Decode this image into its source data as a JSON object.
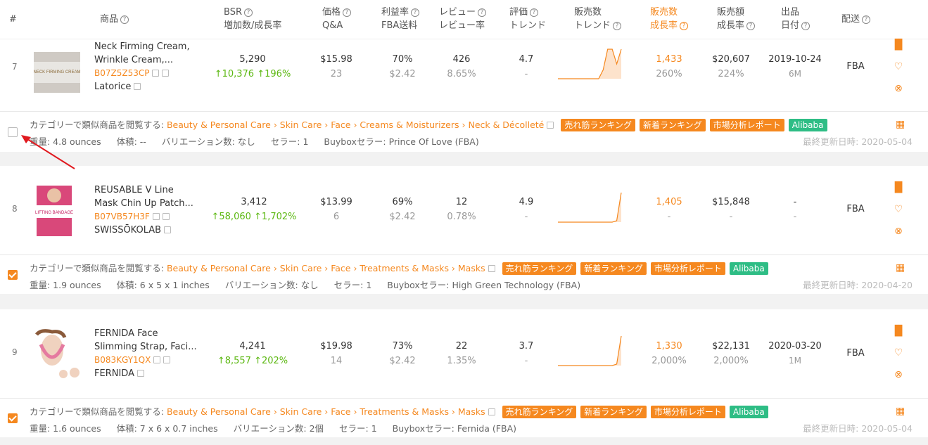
{
  "header": {
    "index": "#",
    "product": "商品",
    "bsr_line1": "BSR",
    "bsr_line2": "増加数/成長率",
    "price_line1": "価格",
    "price_line2": "Q&A",
    "profit_line1": "利益率",
    "profit_line2": "FBA送料",
    "review_line1": "レビュー",
    "review_line2": "レビュー率",
    "rating_line1": "評価",
    "rating_line2": "トレンド",
    "sales_line1": "販売数",
    "sales_line2": "トレンド",
    "salesgrowth_line1": "販売数",
    "salesgrowth_line2": "成長率",
    "revenue_line1": "販売額",
    "revenue_line2": "成長率",
    "listed_line1": "出品",
    "listed_line2": "日付",
    "ship": "配送",
    "accent_color": "#f5881f"
  },
  "rows": [
    {
      "index": "7",
      "name_line1": "Neck Firming Cream,",
      "name_line2": "Wrinkle Cream,...",
      "asin": "B07Z5Z53CP",
      "brand": "Latorice",
      "bsr": "5,290",
      "bsr_inc": "10,376",
      "bsr_rate": "196%",
      "price": "$15.98",
      "qa": "23",
      "profit": "70%",
      "fba": "$2.42",
      "reviews": "426",
      "review_rate": "8.65%",
      "rating": "4.7",
      "rating_trend": "-",
      "sales": "1,433",
      "sales_growth": "260%",
      "revenue": "$20,607",
      "revenue_growth": "224%",
      "date": "2019-10-24",
      "age": "6M",
      "ship": "FBA",
      "category_label": "カテゴリーで類似商品を閲覧する:",
      "category_path": "Beauty & Personal Care › Skin Care › Face › Creams & Moisturizers › Neck & Décolleté",
      "tag1": "売れ筋ランキング",
      "tag2": "新着ランキング",
      "tag3": "市場分析レポート",
      "tag4": "Alibaba",
      "weight": "重量: 4.8 ounces",
      "volume": "体積: --",
      "variation": "バリエーション数: なし",
      "seller": "セラー: 1",
      "buybox": "Buyboxセラー:  Prince Of Love (FBA)",
      "updated": "最終更新日時: 2020-05-04",
      "checked": false,
      "thumb_text": "NECK FIRMING CREAM",
      "sales_trend": [
        0,
        0,
        0,
        0,
        0,
        0,
        0,
        0,
        0,
        0,
        0.3,
        1,
        1,
        0.5,
        1
      ]
    },
    {
      "index": "8",
      "name_line1": "REUSABLE V Line",
      "name_line2": "Mask Chin Up Patch...",
      "asin": "B07VB57H3F",
      "brand": "SWISSŌKOLAB",
      "bsr": "3,412",
      "bsr_inc": "58,060",
      "bsr_rate": "1,702%",
      "price": "$13.99",
      "qa": "6",
      "profit": "69%",
      "fba": "$2.42",
      "reviews": "12",
      "review_rate": "0.78%",
      "rating": "4.9",
      "rating_trend": "-",
      "sales": "1,405",
      "sales_growth": "-",
      "revenue": "$15,848",
      "revenue_growth": "-",
      "date": "-",
      "age": "-",
      "ship": "FBA",
      "category_label": "カテゴリーで類似商品を閲覧する:",
      "category_path": "Beauty & Personal Care › Skin Care › Face › Treatments & Masks › Masks",
      "tag1": "売れ筋ランキング",
      "tag2": "新着ランキング",
      "tag3": "市場分析レポート",
      "tag4": "Alibaba",
      "weight": "重量: 1.9 ounces",
      "volume": "体積: 6 x 5 x 1 inches",
      "variation": "バリエーション数: なし",
      "seller": "セラー: 1",
      "buybox": "Buyboxセラー:  High Green Technology (FBA)",
      "updated": "最終更新日時: 2020-04-20",
      "checked": true,
      "thumb_text": "LIFTING BANDAGE",
      "sales_trend": [
        0,
        0,
        0,
        0,
        0,
        0,
        0,
        0,
        0,
        0,
        0,
        0,
        0,
        0.05,
        1
      ]
    },
    {
      "index": "9",
      "name_line1": "FERNIDA Face",
      "name_line2": "Slimming Strap, Faci...",
      "asin": "B083KGY1QX",
      "brand": "FERNIDA",
      "bsr": "4,241",
      "bsr_inc": "8,557",
      "bsr_rate": "202%",
      "price": "$19.98",
      "qa": "14",
      "profit": "73%",
      "fba": "$2.42",
      "reviews": "22",
      "review_rate": "1.35%",
      "rating": "3.7",
      "rating_trend": "-",
      "sales": "1,330",
      "sales_growth": "2,000%",
      "revenue": "$22,131",
      "revenue_growth": "2,000%",
      "date": "2020-03-20",
      "age": "1M",
      "ship": "FBA",
      "category_label": "カテゴリーで類似商品を閲覧する:",
      "category_path": "Beauty & Personal Care › Skin Care › Face › Treatments & Masks › Masks",
      "tag1": "売れ筋ランキング",
      "tag2": "新着ランキング",
      "tag3": "市場分析レポート",
      "tag4": "Alibaba",
      "weight": "重量: 1.6 ounces",
      "volume": "体積: 7 x 6 x 0.7 inches",
      "variation": "バリエーション数: 2個",
      "seller": "セラー: 1",
      "buybox": "Buyboxセラー:  Fernida (FBA)",
      "updated": "最終更新日時: 2020-05-04",
      "checked": true,
      "thumb_text": "",
      "sales_trend": [
        0,
        0,
        0,
        0,
        0,
        0,
        0,
        0,
        0,
        0,
        0,
        0,
        0,
        0.05,
        1
      ]
    }
  ],
  "icons": {
    "up_arrow": "↑",
    "chart": "chart-bars-icon",
    "heart": "heart-icon",
    "lifebuoy": "support-icon",
    "calc": "calculator-icon",
    "share": "external-link-icon"
  }
}
